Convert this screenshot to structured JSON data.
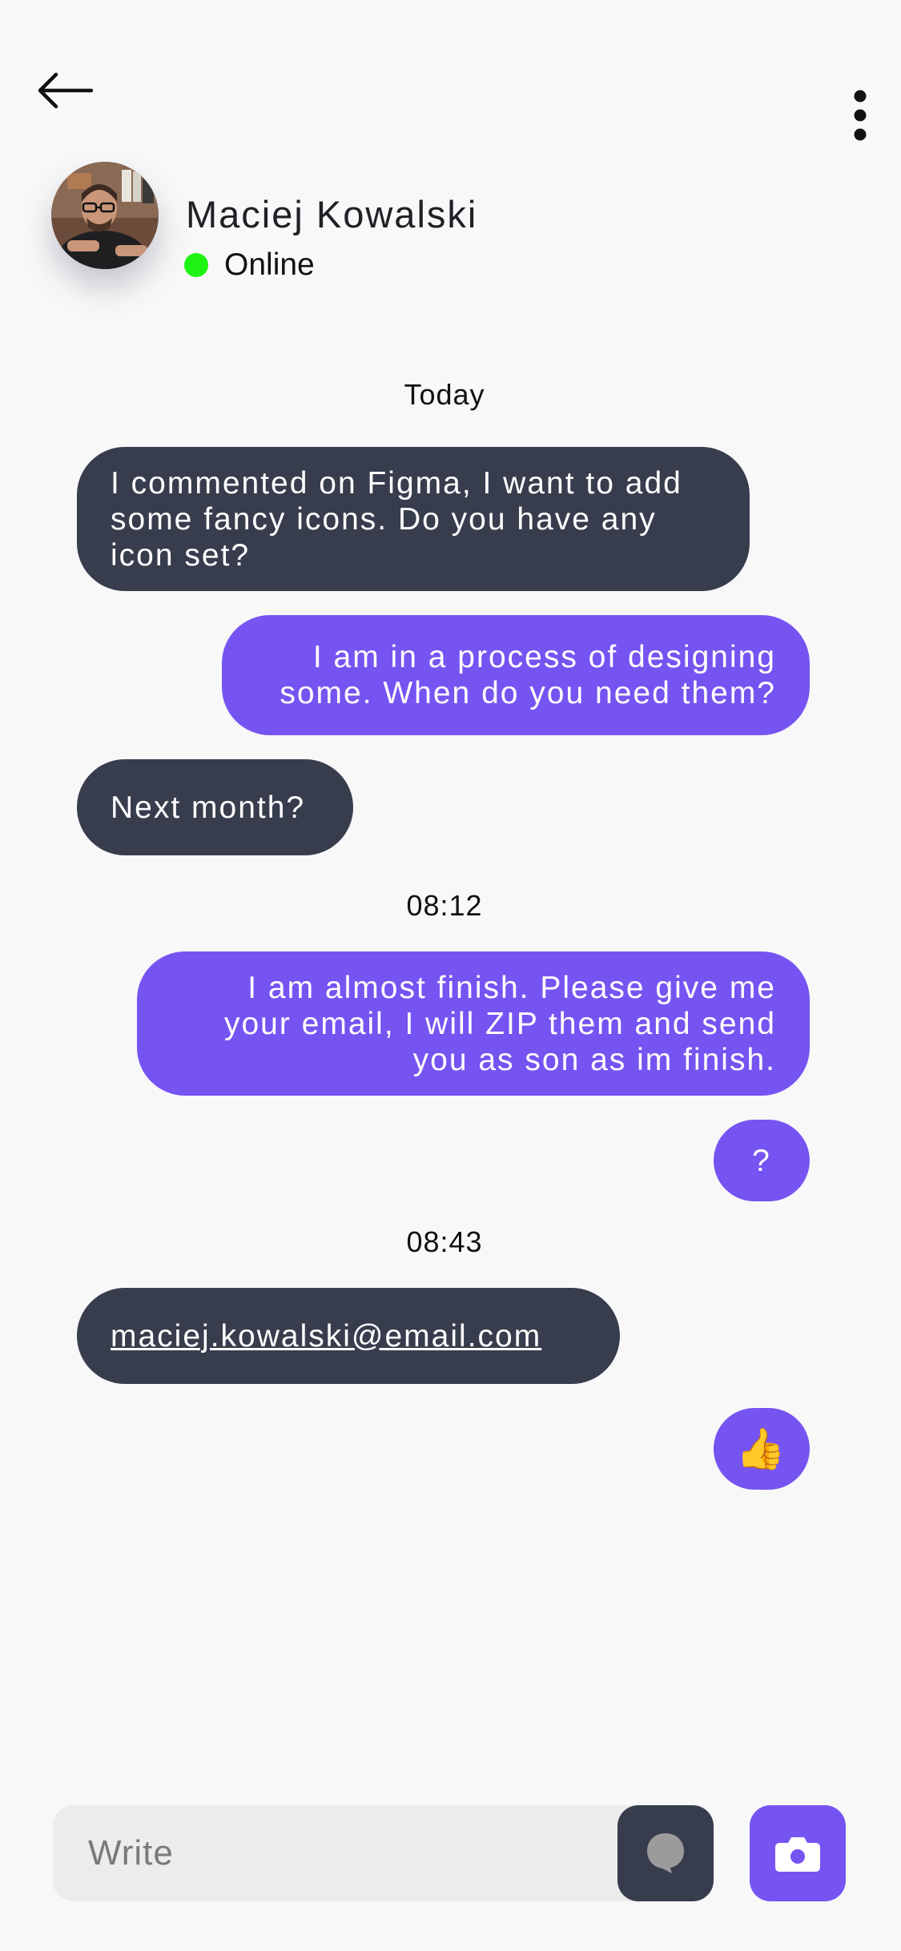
{
  "header": {
    "back_icon": "arrow-left-icon",
    "more_icon": "more-vertical-icon",
    "contact_name": "Maciej Kowalski",
    "status": "Online",
    "status_color": "#1ef313"
  },
  "chat": {
    "dates": [
      "Today",
      "08:12",
      "08:43"
    ],
    "messages": [
      {
        "direction": "incoming",
        "text": "I commented on Figma, I want to add some fancy icons. Do you have any icon set?"
      },
      {
        "direction": "outgoing",
        "text": "I am in a process of designing some. When do you need them?"
      },
      {
        "direction": "incoming",
        "text": "Next month?"
      },
      {
        "direction": "outgoing",
        "text": "I am almost finish. Please give me your email, I will ZIP them and send you as son as im finish."
      },
      {
        "direction": "outgoing",
        "text": "?"
      },
      {
        "direction": "incoming",
        "text": "maciej.kowalski@email.com"
      },
      {
        "direction": "outgoing",
        "text": "👍"
      }
    ]
  },
  "composer": {
    "placeholder": "Write",
    "message_icon": "chat-bubble-icon",
    "camera_icon": "camera-icon"
  },
  "colors": {
    "incoming_bubble": "#383d4e",
    "outgoing_bubble": "#7654f2",
    "background": "#f8f8f9"
  }
}
